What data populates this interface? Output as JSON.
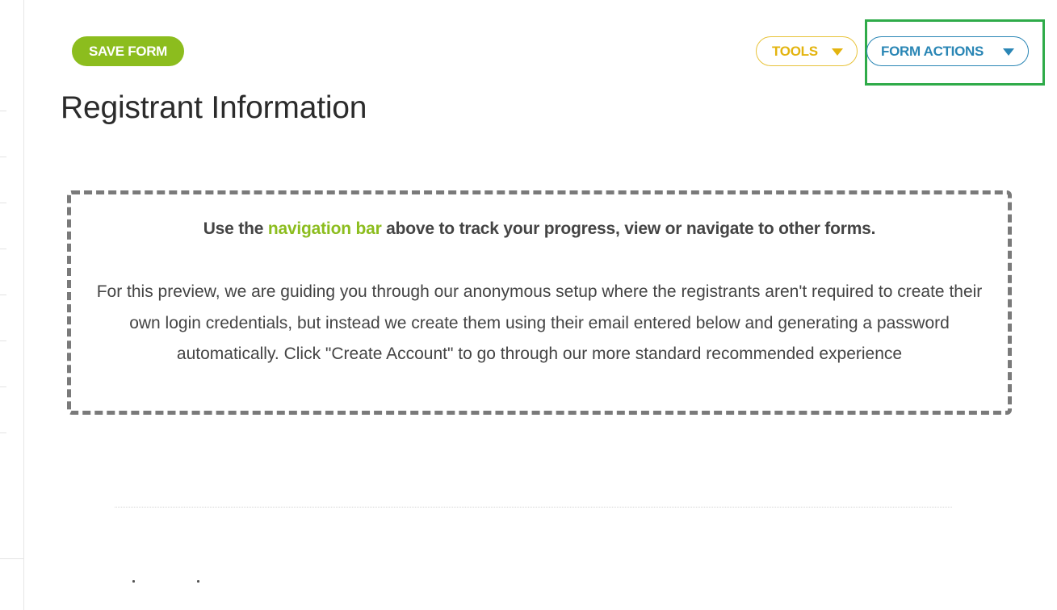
{
  "toolbar": {
    "save_label": "SAVE FORM",
    "tools_label": "TOOLS",
    "form_actions_label": "FORM ACTIONS"
  },
  "page": {
    "title": "Registrant Information"
  },
  "info_box": {
    "lead_before": "Use the ",
    "lead_link": "navigation bar",
    "lead_after": " above to track your progress, view or navigate to other forms.",
    "body": "For this preview, we are guiding you through our anonymous setup where the registrants aren't required to create their own login credentials, but instead we create them using their email entered below and generating a password automatically. Click \"Create Account\" to go through our more standard recommended experience"
  },
  "icons": {
    "tools_caret": "caret-down-icon",
    "form_actions_caret": "caret-down-icon"
  },
  "colors": {
    "save_green": "#8cbd1e",
    "tools_yellow": "#e3b40f",
    "form_actions_blue": "#2a86b5",
    "highlight_green": "#2fab49",
    "dashed_border": "#7a7a7a",
    "link_green": "#8cbd1e"
  }
}
